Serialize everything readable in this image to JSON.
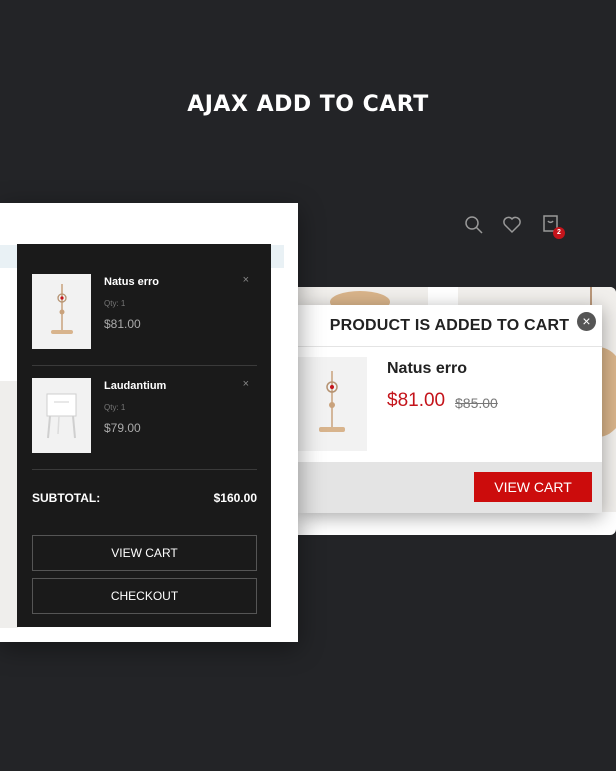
{
  "hero": {
    "title": "AJAX ADD TO CART"
  },
  "header": {
    "cart_count": "2"
  },
  "minicart": {
    "items": [
      {
        "name": "Natus erro",
        "qty": "Qty: 1",
        "price": "$81.00",
        "remove": "×"
      },
      {
        "name": "Laudantium",
        "qty": "Qty: 1",
        "price": "$79.00",
        "remove": "×"
      }
    ],
    "subtotal_label": "SUBTOTAL:",
    "subtotal_value": "$160.00",
    "view_cart_label": "VIEW CART",
    "checkout_label": "CHECKOUT"
  },
  "popup": {
    "title": "PRODUCT IS ADDED TO CART",
    "close": "×",
    "product_name": "Natus erro",
    "price": "$81.00",
    "old_price": "$85.00",
    "view_cart_label": "VIEW CART"
  },
  "colors": {
    "accent": "#cc0c0c",
    "dark": "#1a1a1a",
    "background": "#232427"
  }
}
